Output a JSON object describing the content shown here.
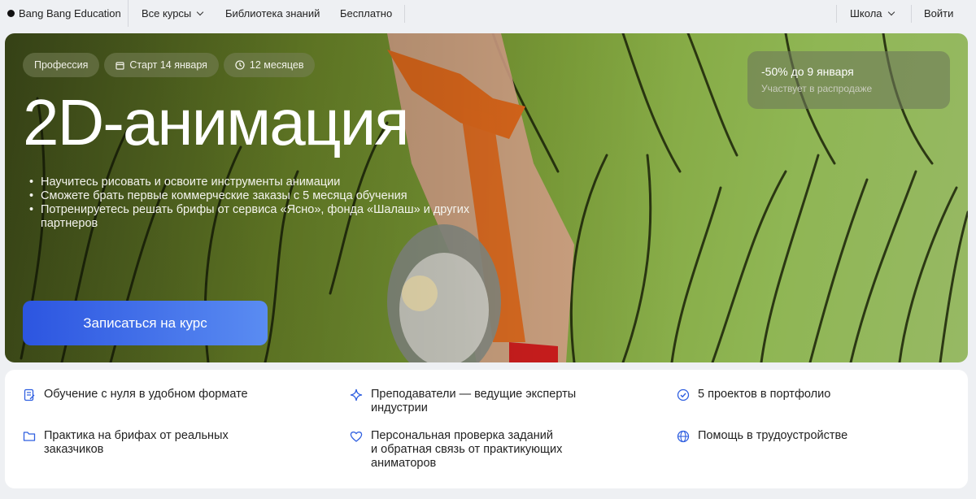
{
  "nav": {
    "logo": "Bang Bang Education",
    "all_courses": "Все курсы",
    "library": "Библиотека знаний",
    "free": "Бесплатно",
    "school": "Школа",
    "login": "Войти"
  },
  "hero": {
    "chips": [
      {
        "label": "Профессия",
        "icon": ""
      },
      {
        "label": "Старт 14 января",
        "icon": "calendar-icon"
      },
      {
        "label": "12 месяцев",
        "icon": "clock-icon"
      }
    ],
    "title": "2D-анимация",
    "bullets": [
      "Научитесь рисовать и освоите инструменты анимации",
      "Сможете брать первые коммерческие заказы с 5 месяца обучения",
      "Потренируетесь решать брифы от сервиса «Ясно», фонда «Шалаш» и других партнеров"
    ],
    "cta": "Записаться на курс",
    "promo": {
      "title": "-50% до 9 января",
      "subtitle": "Участвует в распродаже"
    }
  },
  "features": [
    {
      "icon": "notebook-icon",
      "text": "Обучение с нуля в удобном формате"
    },
    {
      "icon": "sparkle-icon",
      "text": "Преподаватели — ведущие эксперты\nиндустрии"
    },
    {
      "icon": "check-circle-icon",
      "text": "5 проектов в портфолио"
    },
    {
      "icon": "folder-icon",
      "text": "Практика на брифах от реальных\nзаказчиков"
    },
    {
      "icon": "heart-icon",
      "text": "Персональная проверка заданий\nи обратная связь от практикующих\nаниматоров"
    },
    {
      "icon": "globe-icon",
      "text": "Помощь в трудоустройстве"
    }
  ],
  "colors": {
    "accent_start": "#2c55e0",
    "accent_end": "#5a8cf2",
    "icon_blue": "#2f5fe0"
  }
}
